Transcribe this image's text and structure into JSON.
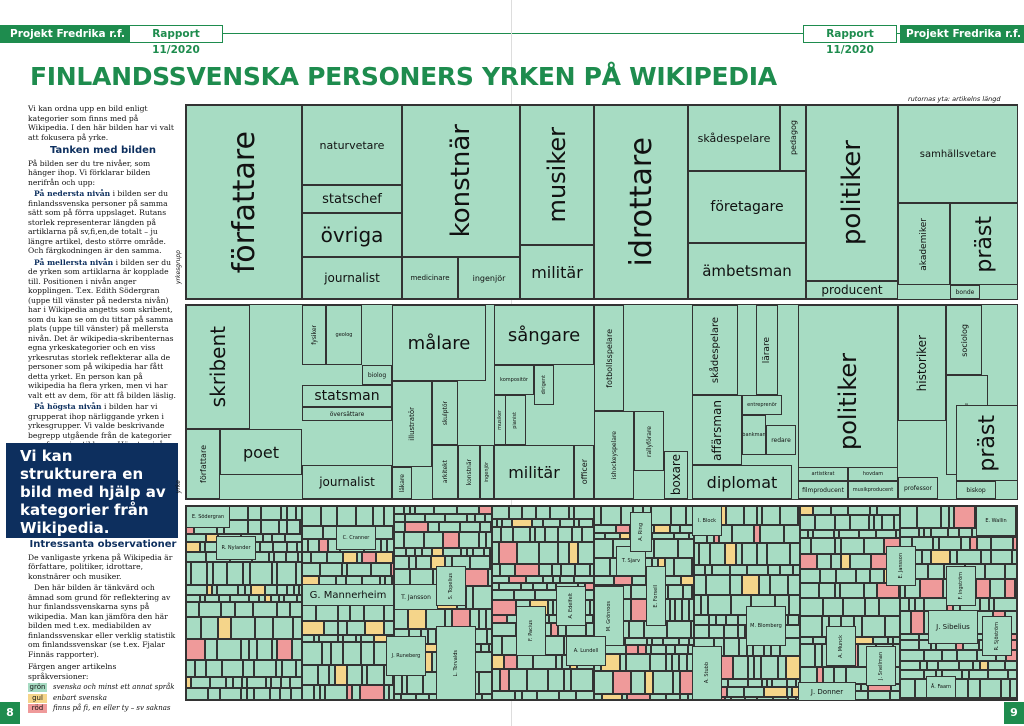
{
  "header": {
    "left_brand": "Projekt Fredrika r.f.",
    "left_report": "Rapport 11/2020",
    "right_report": "Rapport 11/2020",
    "right_brand": "Projekt Fredrika r.f.",
    "accent_color": "#1e8c4e"
  },
  "title": "FINLANDSSVENSKA PERSONERS YRKEN PÅ WIKIPEDIA",
  "intro": "Vi kan ordna upp en bild enligt kategorier som finns med på Wikipedia. I den här bilden har vi valt att fokusera på yrke.",
  "section1": {
    "heading": "Tanken med bilden",
    "p1": "På bilden ser du tre nivåer, som hänger ihop. Vi förklarar bilden nerifrån och upp:",
    "p2_lead": "På nedersta nivån",
    "p2": " i bilden ser du finlandssvenska personer på samma sätt som på förra uppslaget. Rutans storlek representerar längden på artiklarna på sv,fi,en,de totalt – ju längre artikel, desto större område. Och färgkodningen är den samma.",
    "p3_lead": "På mellersta nivån",
    "p3": " i bilden ser du de yrken som artiklarna är kopplade till. Positionen i nivån anger kopplingen. T.ex. Edith Södergran (uppe till vänster på nedersta nivån) har i Wikipedia angetts som skribent, som du kan se om du tittar på samma plats (uppe till vänster) på mellersta nivån. Det är wikipedia-skribenternas egna yrkeskategorier och en viss yrkesrutas storlek reflekterar alla de personer som på wikipedia har fått detta yrket. En person kan på wikipedia ha flera yrken, men vi har valt ett av dem, för att få bilden läslig.",
    "p4_lead": "På högsta nivån",
    "p4": " i bilden har vi grupperat ihop närliggande yrken i yrkesgrupper. Vi valde beskrivande begrepp utgående från de kategorier som fanns i artiklarna. Högsta nivåns rutor hänger ihop med rutor på mellersta nivån på samma sätt genom positionerna inom nivåerna."
  },
  "callout": "Vi kan strukturera en bild med hjälp av kategorier från Wikipedia.",
  "section2": {
    "heading": "Intressanta observationer",
    "p1": "De vanligaste yrkena på Wikipedia är författare, politiker, idrottare, konstnärer och musiker.",
    "p2": "Den här bilden är tänkvärd och ämnad som grund för reflektering av hur finlandssvenskarna syns på wikipedia. Man kan jämföra den här bilden med t.ex. mediabilden av finlandssvenskar eller verklig statistik om finlandssvenskar (se t.ex. Fjalar Finnäs rapporter).",
    "legend_title": "Färgen anger artikelns språkversioner:",
    "legend": [
      {
        "label": "grön",
        "text": "svenska och minst ett annat språk",
        "color": "#a7dcc3"
      },
      {
        "label": "gul",
        "text": "enbart svenska",
        "color": "#f5d58a"
      },
      {
        "label": "röd",
        "text": "finns på fi, en eller ty – sv saknas",
        "color": "#ef9a9a"
      }
    ]
  },
  "chart": {
    "note": "rutornas yta: artikelns längd",
    "tier_labels": {
      "top": "yrkesgrupp",
      "mid": "yrke"
    },
    "top_groups": [
      {
        "label": "författare"
      },
      {
        "label": "naturvetare"
      },
      {
        "label": "statschef"
      },
      {
        "label": "övriga"
      },
      {
        "label": "journalist"
      },
      {
        "label": "medicinare"
      },
      {
        "label": "ingenjör"
      },
      {
        "label": "konstnär"
      },
      {
        "label": "musiker"
      },
      {
        "label": "militär"
      },
      {
        "label": "idrottare"
      },
      {
        "label": "skådespelare"
      },
      {
        "label": "pedagog"
      },
      {
        "label": "företagare"
      },
      {
        "label": "ämbetsman"
      },
      {
        "label": "politiker"
      },
      {
        "label": "producent"
      },
      {
        "label": "samhällsvetare"
      },
      {
        "label": "akademiker"
      },
      {
        "label": "präst"
      },
      {
        "label": "bonde"
      }
    ],
    "mid_groups": [
      {
        "label": "skribent"
      },
      {
        "label": "författare"
      },
      {
        "label": "poet"
      },
      {
        "label": "fysiker"
      },
      {
        "label": "geolog"
      },
      {
        "label": "biolog"
      },
      {
        "label": "statsman"
      },
      {
        "label": "översättare"
      },
      {
        "label": "journalist"
      },
      {
        "label": "målare"
      },
      {
        "label": "illustratör"
      },
      {
        "label": "skulptör"
      },
      {
        "label": "arkitekt"
      },
      {
        "label": "konstnär"
      },
      {
        "label": "läkare"
      },
      {
        "label": "ingenjör"
      },
      {
        "label": "sångare"
      },
      {
        "label": "kompositör"
      },
      {
        "label": "pianist"
      },
      {
        "label": "dirigent"
      },
      {
        "label": "musiker"
      },
      {
        "label": "militär"
      },
      {
        "label": "officer"
      },
      {
        "label": "fotbollsspelare"
      },
      {
        "label": "ishockeyspelare"
      },
      {
        "label": "rallyförare"
      },
      {
        "label": "boxare"
      },
      {
        "label": "skådespelare"
      },
      {
        "label": "lärare"
      },
      {
        "label": "affärsman"
      },
      {
        "label": "entreprenör"
      },
      {
        "label": "bankman"
      },
      {
        "label": "redare"
      },
      {
        "label": "diplomat"
      },
      {
        "label": "politiker"
      },
      {
        "label": "filmproducent"
      },
      {
        "label": "musikproducent"
      },
      {
        "label": "historiker"
      },
      {
        "label": "sociolog"
      },
      {
        "label": "universitetslärare"
      },
      {
        "label": "professor"
      },
      {
        "label": "präst"
      },
      {
        "label": "biskop"
      },
      {
        "label": "artistkrat"
      },
      {
        "label": "hovdam"
      }
    ],
    "people": [
      {
        "label": "E. Södergran"
      },
      {
        "label": "G. Mannerheim"
      },
      {
        "label": "T. Jansson"
      },
      {
        "label": "J. Sibelius"
      },
      {
        "label": "J. Donner"
      },
      {
        "label": "L. Torvalds"
      },
      {
        "label": "A. Stubb"
      },
      {
        "label": "T. Sjarv"
      },
      {
        "label": "R. Nylander"
      },
      {
        "label": "M. Grönroos"
      },
      {
        "label": "I. Block"
      },
      {
        "label": "A. Ring"
      },
      {
        "label": "E. Forsell"
      },
      {
        "label": "J. Runeberg"
      },
      {
        "label": "S. Topelius"
      },
      {
        "label": "F. Pacius"
      },
      {
        "label": "A. Edelfelt"
      },
      {
        "label": "A. Lundell"
      },
      {
        "label": "M. Blomberg"
      },
      {
        "label": "A. Munck"
      },
      {
        "label": "J. Snellman"
      },
      {
        "label": "R. Sjöström"
      },
      {
        "label": "F. Ingström"
      },
      {
        "label": "E. Jansson"
      },
      {
        "label": "C. Cranner"
      },
      {
        "label": "Å. Faarn"
      },
      {
        "label": "E. Wallin"
      }
    ]
  },
  "page_left": "8",
  "page_right": "9"
}
